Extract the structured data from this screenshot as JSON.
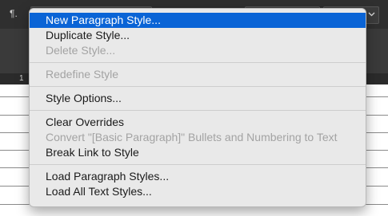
{
  "toolbar": {
    "paragraph_icon": "¶."
  },
  "ruler": {
    "mark": "1"
  },
  "menu": {
    "groups": [
      [
        {
          "label": "New Paragraph Style...",
          "state": "selected"
        },
        {
          "label": "Duplicate Style...",
          "state": "enabled"
        },
        {
          "label": "Delete Style...",
          "state": "disabled"
        }
      ],
      [
        {
          "label": "Redefine Style",
          "state": "disabled"
        }
      ],
      [
        {
          "label": "Style Options...",
          "state": "enabled"
        }
      ],
      [
        {
          "label": "Clear Overrides",
          "state": "enabled"
        },
        {
          "label": "Convert \"[Basic Paragraph]\" Bullets and Numbering to Text",
          "state": "disabled"
        },
        {
          "label": "Break Link to Style",
          "state": "enabled"
        }
      ],
      [
        {
          "label": "Load Paragraph Styles...",
          "state": "enabled"
        },
        {
          "label": "Load All Text Styles...",
          "state": "enabled"
        }
      ]
    ]
  },
  "colors": {
    "selection": "#0a64d6",
    "menu_bg": "#e9e9e9",
    "disabled_text": "#a3a3a3"
  }
}
